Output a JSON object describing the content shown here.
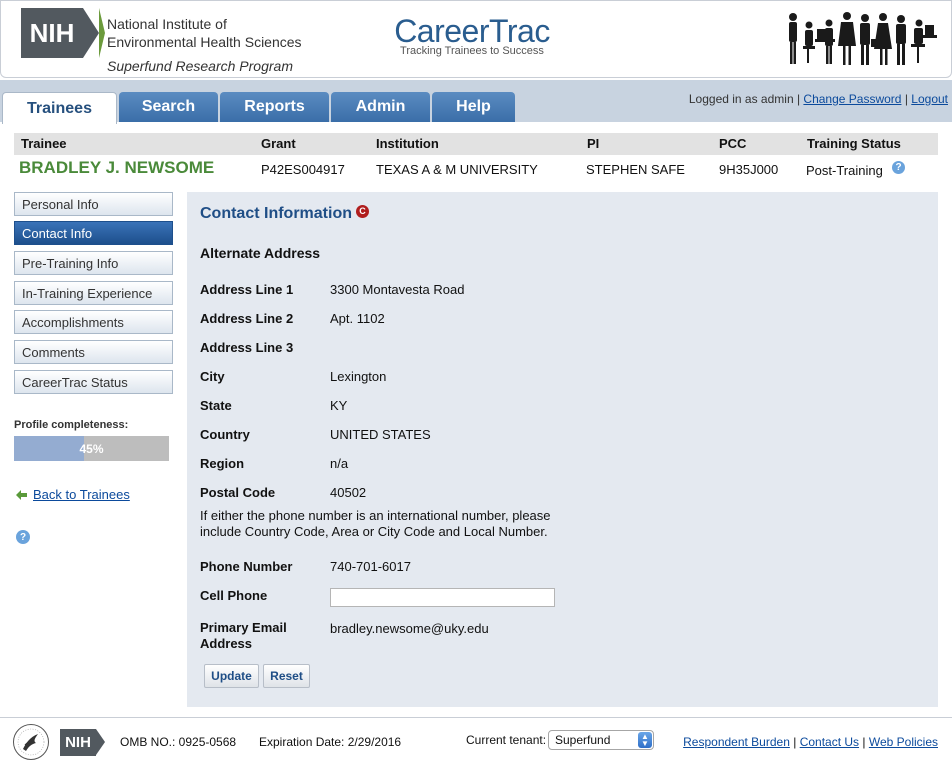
{
  "header": {
    "nih_badge": "NIH",
    "institute_line1": "National Institute of",
    "institute_line2": "Environmental Health Sciences",
    "program": "Superfund Research Program",
    "app_title": "CareerTrac",
    "app_tagline": "Tracking Trainees to Success"
  },
  "nav": {
    "tabs": [
      {
        "label": "Trainees",
        "active": true
      },
      {
        "label": "Search",
        "active": false
      },
      {
        "label": "Reports",
        "active": false
      },
      {
        "label": "Admin",
        "active": false
      },
      {
        "label": "Help",
        "active": false
      }
    ],
    "logged_in_text": "Logged in as admin |",
    "change_password": "Change Password",
    "separator": "|",
    "logout": "Logout"
  },
  "trainee_table": {
    "headers": [
      "Trainee",
      "Grant",
      "Institution",
      "PI",
      "PCC",
      "Training Status"
    ],
    "row": {
      "trainee": "BRADLEY J. NEWSOME",
      "grant": "P42ES004917",
      "institution": "TEXAS A & M UNIVERSITY",
      "pi": "STEPHEN SAFE",
      "pcc": "9H35J000",
      "status": "Post-Training"
    }
  },
  "sidebar": {
    "items": [
      {
        "label": "Personal Info",
        "active": false
      },
      {
        "label": "Contact Info",
        "active": true
      },
      {
        "label": "Pre-Training Info",
        "active": false
      },
      {
        "label": "In-Training Experience",
        "active": false
      },
      {
        "label": "Accomplishments",
        "active": false
      },
      {
        "label": "Comments",
        "active": false
      },
      {
        "label": "CareerTrac Status",
        "active": false
      }
    ],
    "completeness_label": "Profile completeness:",
    "completeness_value": 45,
    "completeness_text": "45%",
    "back_link": "Back to Trainees"
  },
  "contact": {
    "title": "Contact Information",
    "c_badge": "C",
    "section": "Alternate Address",
    "fields": [
      {
        "label": "Address Line 1",
        "value": "3300 Montavesta Road"
      },
      {
        "label": "Address Line 2",
        "value": "Apt. 1102"
      },
      {
        "label": "Address Line 3",
        "value": ""
      },
      {
        "label": "City",
        "value": "Lexington"
      },
      {
        "label": "State",
        "value": "KY"
      },
      {
        "label": "Country",
        "value": "UNITED STATES"
      },
      {
        "label": "Region",
        "value": "n/a"
      },
      {
        "label": "Postal Code",
        "value": "40502"
      }
    ],
    "intl_note": "If either the phone number is an international number, please include Country Code, Area or City Code and Local Number.",
    "phone_label": "Phone Number",
    "phone_value": "740-701-6017",
    "cell_label": "Cell Phone",
    "cell_value": "",
    "email_label_1": "Primary Email",
    "email_label_2": "Address",
    "email_value": "bradley.newsome@uky.edu",
    "update_button": "Update",
    "reset_button": "Reset"
  },
  "footer": {
    "nih_badge": "NIH",
    "omb": "OMB NO.: 0925-0568",
    "expiration": "Expiration Date: 2/29/2016",
    "tenant_label": "Current tenant:",
    "tenant_value": "Superfund",
    "links": [
      "Respondent Burden",
      "Contact Us",
      "Web Policies"
    ],
    "link_separator": "|"
  },
  "colors": {
    "accent": "#1f4e86",
    "trainee_name": "#4a8a3a",
    "tab_blue": "#3a6ea8",
    "panel_bg": "#e4e9f0",
    "progress_fill": "#94acd1"
  }
}
